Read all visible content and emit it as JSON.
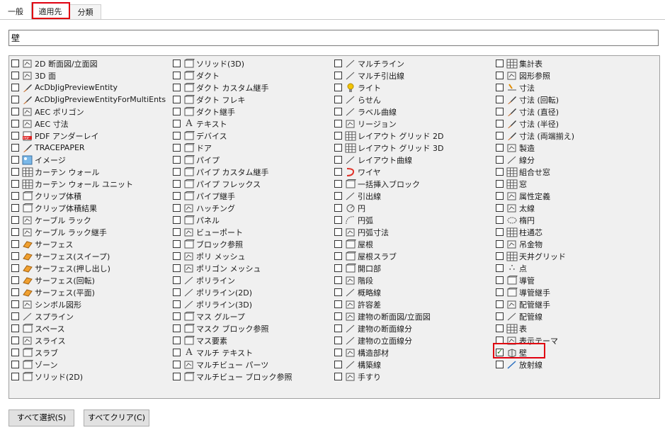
{
  "tabs": [
    "一般",
    "適用先",
    "分類"
  ],
  "search": {
    "value": "壁"
  },
  "columns": [
    [
      {
        "label": "2D 断面図/立面図",
        "icon": "building-section-icon",
        "checked": false
      },
      {
        "label": "3D 面",
        "icon": "3d-face-icon",
        "checked": false
      },
      {
        "label": "AcDbJigPreviewEntity",
        "icon": "brush-icon",
        "checked": false
      },
      {
        "label": "AcDbJigPreviewEntityForMultiEnts",
        "icon": "brush-icon",
        "checked": false
      },
      {
        "label": "AEC ポリゴン",
        "icon": "aec-polygon-icon",
        "checked": false
      },
      {
        "label": "AEC 寸法",
        "icon": "aec-dimension-icon",
        "checked": false
      },
      {
        "label": "PDF アンダーレイ",
        "icon": "pdf-icon",
        "checked": false
      },
      {
        "label": "TRACEPAPER",
        "icon": "brush-icon",
        "checked": false
      },
      {
        "label": "イメージ",
        "icon": "image-icon",
        "checked": false
      },
      {
        "label": "カーテン ウォール",
        "icon": "curtain-wall-icon",
        "checked": false
      },
      {
        "label": "カーテン ウォール ユニット",
        "icon": "curtain-wall-unit-icon",
        "checked": false
      },
      {
        "label": "クリップ体積",
        "icon": "clip-volume-icon",
        "checked": false
      },
      {
        "label": "クリップ体積結果",
        "icon": "clip-volume-result-icon",
        "checked": false
      },
      {
        "label": "ケーブル ラック",
        "icon": "cable-tray-icon",
        "checked": false
      },
      {
        "label": "ケーブル ラック継手",
        "icon": "cable-tray-fitting-icon",
        "checked": false
      },
      {
        "label": "サーフェス",
        "icon": "surface-icon",
        "checked": false
      },
      {
        "label": "サーフェス(スイープ)",
        "icon": "surface-sweep-icon",
        "checked": false
      },
      {
        "label": "サーフェス(押し出し)",
        "icon": "surface-extrude-icon",
        "checked": false
      },
      {
        "label": "サーフェス(回転)",
        "icon": "surface-revolve-icon",
        "checked": false
      },
      {
        "label": "サーフェス(平面)",
        "icon": "surface-planar-icon",
        "checked": false
      },
      {
        "label": "シンボル図形",
        "icon": "symbol-icon",
        "checked": false
      },
      {
        "label": "スプライン",
        "icon": "spline-icon",
        "checked": false
      },
      {
        "label": "スペース",
        "icon": "space-icon",
        "checked": false
      },
      {
        "label": "スライス",
        "icon": "slice-icon",
        "checked": false
      },
      {
        "label": "スラブ",
        "icon": "slab-icon",
        "checked": false
      },
      {
        "label": "ゾーン",
        "icon": "zone-icon",
        "checked": false
      },
      {
        "label": "ソリッド(2D)",
        "icon": "solid-2d-icon",
        "checked": false
      }
    ],
    [
      {
        "label": "ソリッド(3D)",
        "icon": "solid-3d-icon",
        "checked": false
      },
      {
        "label": "ダクト",
        "icon": "duct-icon",
        "checked": false
      },
      {
        "label": "ダクト カスタム継手",
        "icon": "duct-custom-fitting-icon",
        "checked": false
      },
      {
        "label": "ダクト フレキ",
        "icon": "duct-flex-icon",
        "checked": false
      },
      {
        "label": "ダクト継手",
        "icon": "duct-fitting-icon",
        "checked": false
      },
      {
        "label": "テキスト",
        "icon": "text-icon",
        "checked": false
      },
      {
        "label": "デバイス",
        "icon": "device-icon",
        "checked": false
      },
      {
        "label": "ドア",
        "icon": "door-icon",
        "checked": false
      },
      {
        "label": "パイプ",
        "icon": "pipe-icon",
        "checked": false
      },
      {
        "label": "パイプ カスタム継手",
        "icon": "pipe-custom-fitting-icon",
        "checked": false
      },
      {
        "label": "パイプ フレックス",
        "icon": "pipe-flex-icon",
        "checked": false
      },
      {
        "label": "パイプ継手",
        "icon": "pipe-fitting-icon",
        "checked": false
      },
      {
        "label": "ハッチング",
        "icon": "hatch-icon",
        "checked": false
      },
      {
        "label": "パネル",
        "icon": "panel-icon",
        "checked": false
      },
      {
        "label": "ビューポート",
        "icon": "viewport-icon",
        "checked": false
      },
      {
        "label": "ブロック参照",
        "icon": "block-reference-icon",
        "checked": false
      },
      {
        "label": "ポリ メッシュ",
        "icon": "poly-mesh-icon",
        "checked": false
      },
      {
        "label": "ポリゴン メッシュ",
        "icon": "polygon-mesh-icon",
        "checked": false
      },
      {
        "label": "ポリライン",
        "icon": "polyline-icon",
        "checked": false
      },
      {
        "label": "ポリライン(2D)",
        "icon": "polyline-2d-icon",
        "checked": false
      },
      {
        "label": "ポリライン(3D)",
        "icon": "polyline-3d-icon",
        "checked": false
      },
      {
        "label": "マス グループ",
        "icon": "mass-group-icon",
        "checked": false
      },
      {
        "label": "マスク ブロック参照",
        "icon": "mask-block-reference-icon",
        "checked": false
      },
      {
        "label": "マス要素",
        "icon": "mass-element-icon",
        "checked": false
      },
      {
        "label": "マルチ テキスト",
        "icon": "mtext-icon",
        "checked": false
      },
      {
        "label": "マルチビュー パーツ",
        "icon": "multiview-part-icon",
        "checked": false
      },
      {
        "label": "マルチビュー ブロック参照",
        "icon": "multiview-block-icon",
        "checked": false
      }
    ],
    [
      {
        "label": "マルチライン",
        "icon": "multiline-icon",
        "checked": false
      },
      {
        "label": "マルチ引出線",
        "icon": "multileader-icon",
        "checked": false
      },
      {
        "label": "ライト",
        "icon": "light-icon",
        "checked": false
      },
      {
        "label": "らせん",
        "icon": "helix-icon",
        "checked": false
      },
      {
        "label": "ラベル曲線",
        "icon": "label-curve-icon",
        "checked": false
      },
      {
        "label": "リージョン",
        "icon": "region-icon",
        "checked": false
      },
      {
        "label": "レイアウト グリッド 2D",
        "icon": "layout-grid-2d-icon",
        "checked": false
      },
      {
        "label": "レイアウト グリッド 3D",
        "icon": "layout-grid-3d-icon",
        "checked": false
      },
      {
        "label": "レイアウト曲線",
        "icon": "layout-curve-icon",
        "checked": false
      },
      {
        "label": "ワイヤ",
        "icon": "wire-icon",
        "checked": false
      },
      {
        "label": "一括挿入ブロック",
        "icon": "minsert-block-icon",
        "checked": false
      },
      {
        "label": "引出線",
        "icon": "leader-icon",
        "checked": false
      },
      {
        "label": "円",
        "icon": "circle-icon",
        "checked": false
      },
      {
        "label": "円弧",
        "icon": "arc-icon",
        "checked": false
      },
      {
        "label": "円弧寸法",
        "icon": "arc-dimension-icon",
        "checked": false
      },
      {
        "label": "屋根",
        "icon": "roof-icon",
        "checked": false
      },
      {
        "label": "屋根スラブ",
        "icon": "roof-slab-icon",
        "checked": false
      },
      {
        "label": "開口部",
        "icon": "opening-icon",
        "checked": false
      },
      {
        "label": "階段",
        "icon": "stair-icon",
        "checked": false
      },
      {
        "label": "概略線",
        "icon": "sketch-line-icon",
        "checked": false
      },
      {
        "label": "許容差",
        "icon": "tolerance-icon",
        "checked": false
      },
      {
        "label": "建物の断面図/立面図",
        "icon": "building-elevation-icon",
        "checked": false
      },
      {
        "label": "建物の断面線分",
        "icon": "section-line-icon",
        "checked": false
      },
      {
        "label": "建物の立面線分",
        "icon": "elevation-line-icon",
        "checked": false
      },
      {
        "label": "構造部材",
        "icon": "structural-member-icon",
        "checked": false
      },
      {
        "label": "構築線",
        "icon": "construction-line-icon",
        "checked": false
      },
      {
        "label": "手すり",
        "icon": "railing-icon",
        "checked": false
      }
    ],
    [
      {
        "label": "集計表",
        "icon": "schedule-table-icon",
        "checked": false
      },
      {
        "label": "図形参照",
        "icon": "shape-reference-icon",
        "checked": false
      },
      {
        "label": "寸法",
        "icon": "dimension-icon",
        "checked": false
      },
      {
        "label": "寸法 (回転)",
        "icon": "brush-icon",
        "checked": false
      },
      {
        "label": "寸法 (直径)",
        "icon": "brush-icon",
        "checked": false
      },
      {
        "label": "寸法 (半径)",
        "icon": "brush-icon",
        "checked": false
      },
      {
        "label": "寸法 (両端揃え)",
        "icon": "brush-icon",
        "checked": false
      },
      {
        "label": "製造",
        "icon": "fabrication-icon",
        "checked": false
      },
      {
        "label": "線分",
        "icon": "line-icon",
        "checked": false
      },
      {
        "label": "組合せ窓",
        "icon": "window-assembly-icon",
        "checked": false
      },
      {
        "label": "窓",
        "icon": "window-icon",
        "checked": false
      },
      {
        "label": "属性定義",
        "icon": "attribute-definition-icon",
        "checked": false
      },
      {
        "label": "太線",
        "icon": "trace-icon",
        "checked": false
      },
      {
        "label": "楕円",
        "icon": "ellipse-icon",
        "checked": false
      },
      {
        "label": "柱通芯",
        "icon": "column-grid-icon",
        "checked": false
      },
      {
        "label": "吊金物",
        "icon": "hanger-icon",
        "checked": false
      },
      {
        "label": "天井グリッド",
        "icon": "ceiling-grid-icon",
        "checked": false
      },
      {
        "label": "点",
        "icon": "point-icon",
        "checked": false
      },
      {
        "label": "導管",
        "icon": "conduit-icon",
        "checked": false
      },
      {
        "label": "導管継手",
        "icon": "conduit-fitting-icon",
        "checked": false
      },
      {
        "label": "配管継手",
        "icon": "piping-fitting-icon",
        "checked": false
      },
      {
        "label": "配管線",
        "icon": "piping-line-icon",
        "checked": false
      },
      {
        "label": "表",
        "icon": "table-icon",
        "checked": false
      },
      {
        "label": "表示テーマ",
        "icon": "display-theme-icon",
        "checked": false
      },
      {
        "label": "壁",
        "icon": "wall-icon",
        "checked": true
      },
      {
        "label": "放射線",
        "icon": "ray-icon",
        "checked": false
      }
    ]
  ],
  "buttons": {
    "select_all": "すべて選択(S)",
    "clear_all": "すべてクリア(C)"
  },
  "colors": {
    "highlight": "#e00010",
    "panel_bg": "#f0f0f0"
  }
}
